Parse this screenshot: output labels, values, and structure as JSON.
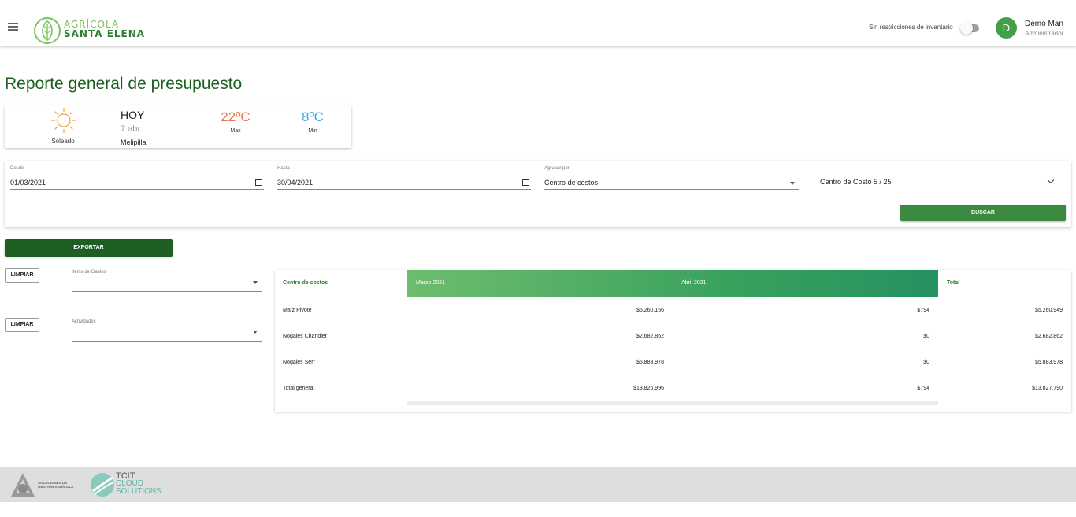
{
  "header": {
    "brand_line1": "AGRÍCOLA",
    "brand_line2": "SANTA ELENA",
    "inventory_label": "Sin restricciones de inventario",
    "inventory_toggle_on": false,
    "avatar_letter": "D",
    "user_name": "Demo Man",
    "user_role": "Administrador"
  },
  "page": {
    "title": "Reporte general de presupuesto"
  },
  "weather": {
    "condition": "Soleado",
    "today": "HOY",
    "date": "7 abr.",
    "city": "Melipilla",
    "max_temp": "22ºC",
    "max_label": "Max",
    "min_temp": "8ºC",
    "min_label": "Min"
  },
  "filters": {
    "desde_label": "Desde",
    "desde_value": "01/03/2021",
    "hasta_label": "Hasta",
    "hasta_value": "30/04/2021",
    "agrupar_label": "Agrupar por",
    "agrupar_value": "Centro de costos",
    "centro_costo_value": "Centro de Costo 5 / 25",
    "buscar_label": "BUSCAR"
  },
  "actions": {
    "exportar_label": "EXPORTAR",
    "limpiar1_label": "LIMPIAR",
    "limpiar2_label": "LIMPIAR",
    "items_gastos_label": "Items de Gastos",
    "actividades_label": "Actividades"
  },
  "table": {
    "headers": [
      "Centro de costos",
      "Marzo 2021",
      "Abril 2021",
      "Total"
    ],
    "rows": [
      [
        "Maíz Pivote",
        "$5.260.156",
        "$794",
        "$5.260.949"
      ],
      [
        "Nogales Chandler",
        "$2.682.862",
        "$0",
        "$2.682.862"
      ],
      [
        "Nogales Serr",
        "$5.883.978",
        "$0",
        "$5.883.978"
      ],
      [
        "Total general",
        "$13.826.996",
        "$794",
        "$13.827.790"
      ]
    ]
  },
  "footer": {
    "agr_text_line1": "SOLUCIONES DE",
    "agr_text_line2": "GESTIÓN AGRÍCOLA",
    "tcit_line1": "TCIT",
    "tcit_line2": "CLOUD",
    "tcit_line3": "SOLUTIONS"
  },
  "colors": {
    "brand_green": "#1b5e20",
    "button_green": "#3c8a3f",
    "export_green": "#1f5e23",
    "max_temp": "#e8734f",
    "min_temp": "#4aa6e0"
  },
  "icons": [
    "menu-icon",
    "leaf-logo-icon",
    "sun-icon",
    "calendar-icon",
    "caret-down-icon",
    "chevron-down-icon",
    "agr-logo-icon",
    "tcit-logo-icon"
  ]
}
